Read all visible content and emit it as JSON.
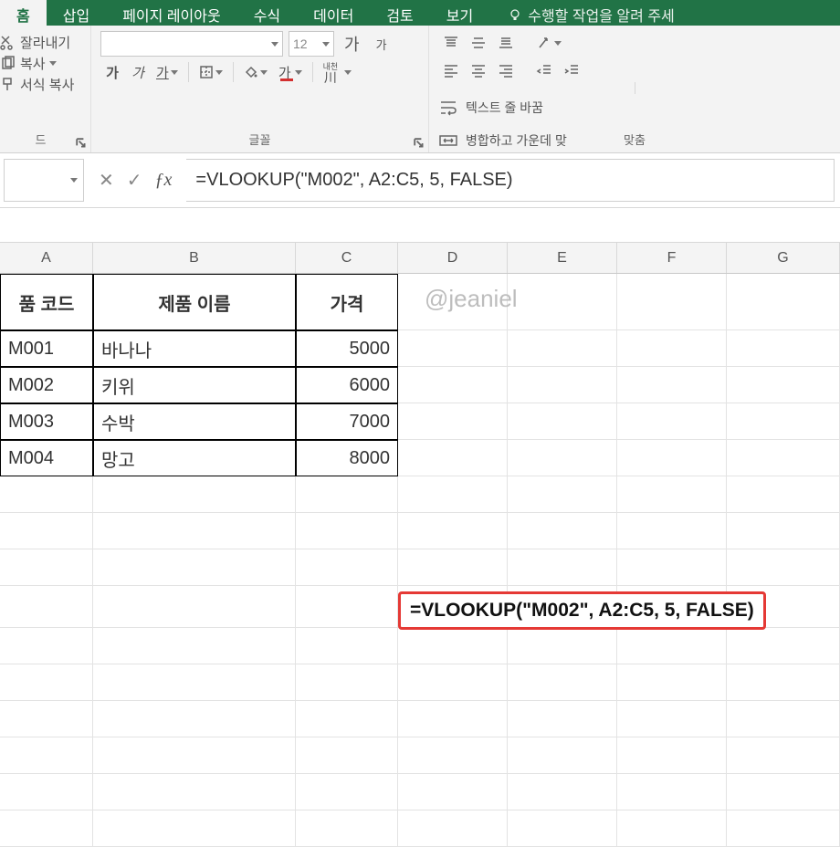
{
  "tabs": {
    "home": "홈",
    "insert": "삽입",
    "layout": "페이지 레이아웃",
    "formulas": "수식",
    "data": "데이터",
    "review": "검토",
    "view": "보기",
    "tellme": "수행할 작업을 알려 주세"
  },
  "clipboard": {
    "cut": "잘라내기",
    "copy": "복사",
    "format_painter": "서식 복사",
    "group_label": "드"
  },
  "font": {
    "size": "12",
    "increase": "가",
    "decrease": "가",
    "bold": "가",
    "italic": "가",
    "underline": "가",
    "font_color": "가",
    "ruby": "내천",
    "group_label": "글꼴"
  },
  "align": {
    "wrap": "텍스트 줄 바꿈",
    "merge": "병합하고 가운데 맞",
    "group_label": "맞춤"
  },
  "formula_bar": {
    "formula": "=VLOOKUP(\"M002\", A2:C5, 5, FALSE)"
  },
  "columns": {
    "A": "A",
    "B": "B",
    "C": "C",
    "D": "D",
    "E": "E",
    "F": "F",
    "G": "G"
  },
  "table": {
    "headers": {
      "code": "품 코드",
      "name": "제품 이름",
      "price": "가격"
    },
    "rows": [
      {
        "code": "M001",
        "name": "바나나",
        "price": "5000"
      },
      {
        "code": "M002",
        "name": "키위",
        "price": "6000"
      },
      {
        "code": "M003",
        "name": "수박",
        "price": "7000"
      },
      {
        "code": "M004",
        "name": "망고",
        "price": "8000"
      }
    ]
  },
  "watermark": "@jeaniel",
  "callout": "=VLOOKUP(\"M002\", A2:C5, 5, FALSE)"
}
